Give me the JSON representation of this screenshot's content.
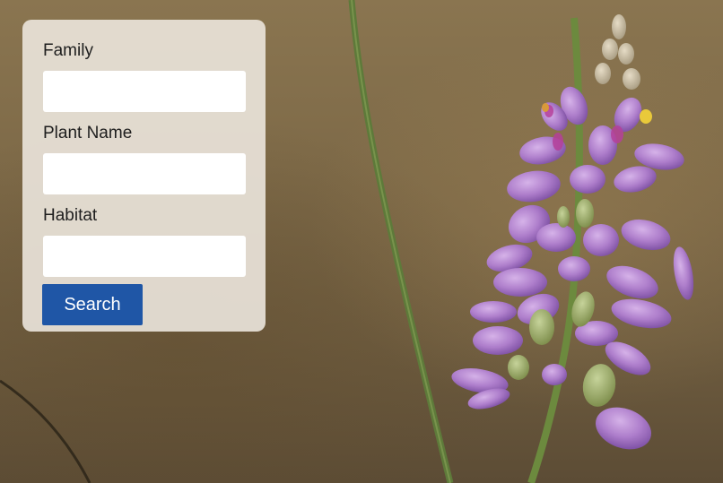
{
  "form": {
    "fields": [
      {
        "label": "Family",
        "value": "",
        "placeholder": ""
      },
      {
        "label": "Plant Name",
        "value": "",
        "placeholder": ""
      },
      {
        "label": "Habitat",
        "value": "",
        "placeholder": ""
      }
    ],
    "submit_label": "Search"
  },
  "colors": {
    "panel_background": "#e8e2d8",
    "button_background": "#1f56a6",
    "button_text": "#ffffff",
    "background_tone": "#7e6a48",
    "flower_petal": "#b07fd0",
    "stem": "#5e7a3a"
  }
}
